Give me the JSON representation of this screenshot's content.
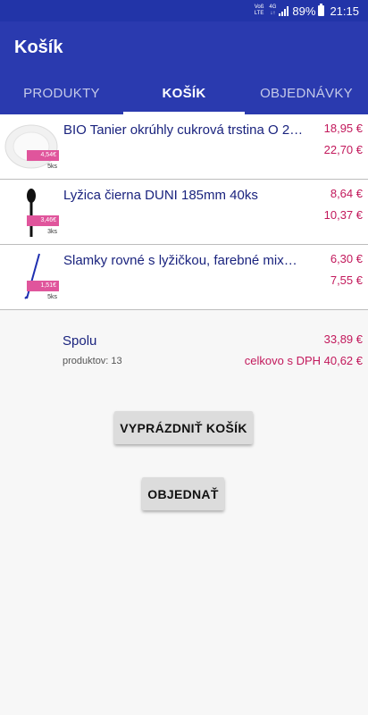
{
  "status_bar": {
    "carrier_top": "Voß",
    "carrier_bottom": "LTE",
    "network_top": "4G",
    "network_bottom": "↓↑",
    "battery": "89%",
    "time": "21:15"
  },
  "app": {
    "title": "Košík"
  },
  "tabs": [
    {
      "label": "PRODUKTY",
      "active": false
    },
    {
      "label": "KOŠÍK",
      "active": true
    },
    {
      "label": "OBJEDNÁVKY",
      "active": false
    }
  ],
  "cart_items": [
    {
      "name": "BIO Tanier okrúhly cukrová trstina O 2…",
      "thumb_price": "4,54€",
      "thumb_qty": "5ks",
      "price": "18,95 €",
      "price_vat": "22,70 €",
      "icon": "plate-icon"
    },
    {
      "name": "Lyžica čierna DUNI 185mm 40ks",
      "thumb_price": "3,46€",
      "thumb_qty": "3ks",
      "price": "8,64 €",
      "price_vat": "10,37 €",
      "icon": "spoon-icon"
    },
    {
      "name": "Slamky rovné s lyžičkou, farebné mix…",
      "thumb_price": "1,51€",
      "thumb_qty": "5ks",
      "price": "6,30 €",
      "price_vat": "7,55 €",
      "icon": "straw-icon"
    }
  ],
  "summary": {
    "label": "Spolu",
    "count": "produktov: 13",
    "total": "33,89 €",
    "total_vat": "celkovo s DPH 40,62 €"
  },
  "buttons": {
    "empty_cart": "VYPRÁZDNIŤ KOŠÍK",
    "order": "OBJEDNAŤ"
  },
  "colors": {
    "app_bar": "#2a3aaf",
    "status_bar": "#2234a8",
    "price": "#c2185b",
    "badge": "#e0559c",
    "text_primary": "#1a237e"
  }
}
